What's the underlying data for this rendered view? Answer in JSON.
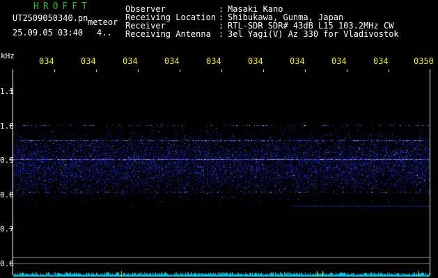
{
  "header": {
    "brand": "HROFFT",
    "filename": "UT2509050340.pn",
    "tag": "meteor",
    "datetime": "25.09.05 03:40",
    "channel": "4.."
  },
  "info": [
    {
      "label": "Observer",
      "value": "Masaki Kano"
    },
    {
      "label": "Receiving Location",
      "value": "Shibukawa, Gunma, Japan"
    },
    {
      "label": "Receiver",
      "value": "RTL-SDR SDR# 43dB L15 103.2MHz CW"
    },
    {
      "label": "Receiving Antenna",
      "value": "3el Yagi(V) Az 330 for Vladivostok"
    }
  ],
  "axis": {
    "unit": "kHz",
    "x_ticks": [
      "034",
      "034",
      "034",
      "034",
      "034",
      "034",
      "034",
      "034",
      "034",
      "0350"
    ],
    "y_ticks": [
      "1.1",
      "1.0",
      "0.9",
      "0.8",
      "0.7",
      "0.6"
    ]
  },
  "colors": {
    "noise": "#1e28c8",
    "bright": "#78b4ff",
    "brand": "#1ec81e",
    "ticks": "#f0f000",
    "baseline": "#00c8e6"
  }
}
